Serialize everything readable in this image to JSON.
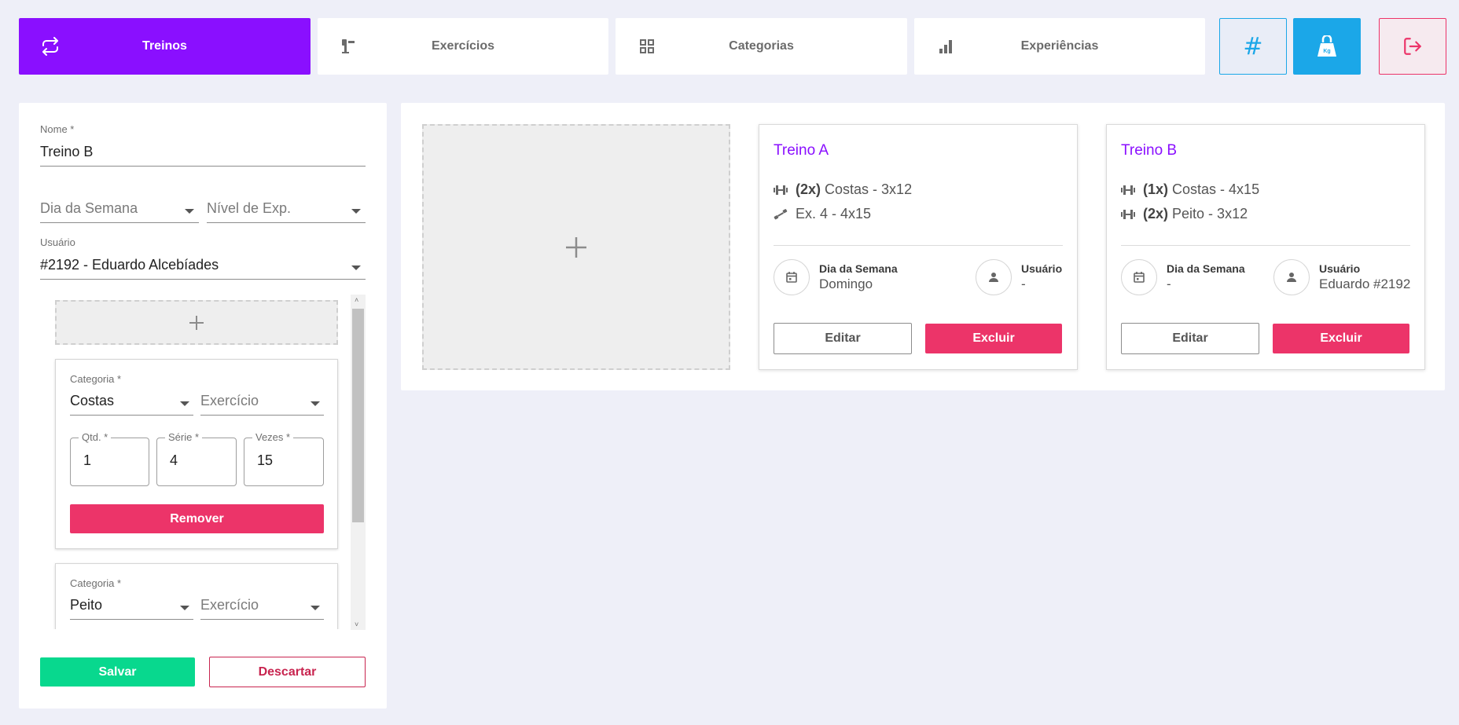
{
  "nav": {
    "tabs": [
      {
        "label": "Treinos",
        "icon": "repeat-icon"
      },
      {
        "label": "Exercícios",
        "icon": "weight-machine-icon"
      },
      {
        "label": "Categorias",
        "icon": "grid-icon"
      },
      {
        "label": "Experiências",
        "icon": "bar-chart-icon"
      }
    ],
    "hash_icon": "#"
  },
  "form": {
    "nome": {
      "label": "Nome *",
      "value": "Treino B"
    },
    "dia_semana": {
      "placeholder": "Dia da Semana"
    },
    "nivel_exp": {
      "placeholder": "Nível de Exp."
    },
    "usuario": {
      "label": "Usuário",
      "value": "#2192 - Eduardo Alcebíades"
    },
    "exercises": [
      {
        "categoria_label": "Categoria *",
        "categoria": "Costas",
        "exercicio_placeholder": "Exercício",
        "qtd_label": "Qtd. *",
        "qtd": "1",
        "serie_label": "Série *",
        "serie": "4",
        "vezes_label": "Vezes *",
        "vezes": "15",
        "remove_label": "Remover"
      },
      {
        "categoria_label": "Categoria *",
        "categoria": "Peito",
        "exercicio_placeholder": "Exercício"
      }
    ],
    "save_label": "Salvar",
    "discard_label": "Descartar"
  },
  "workouts": [
    {
      "title": "Treino A",
      "exercises": [
        {
          "mult": "(2x)",
          "text": "Costas - 3x12",
          "icon": "dumbbell-icon"
        },
        {
          "mult": "",
          "text": "Ex. 4 - 4x15",
          "icon": "stretch-icon"
        }
      ],
      "dia_label": "Dia da Semana",
      "dia": "Domingo",
      "usuario_label": "Usuário",
      "usuario": "-",
      "edit_label": "Editar",
      "delete_label": "Excluir"
    },
    {
      "title": "Treino B",
      "exercises": [
        {
          "mult": "(1x)",
          "text": "Costas - 4x15",
          "icon": "dumbbell-icon"
        },
        {
          "mult": "(2x)",
          "text": "Peito - 3x12",
          "icon": "dumbbell-icon"
        }
      ],
      "dia_label": "Dia da Semana",
      "dia": "-",
      "usuario_label": "Usuário",
      "usuario": "Eduardo #2192",
      "edit_label": "Editar",
      "delete_label": "Excluir"
    }
  ],
  "colors": {
    "primary": "#8a0fff",
    "accent_blue": "#1ba7e8",
    "danger": "#ec3469",
    "success": "#08d88e",
    "background": "#eeeff8"
  }
}
